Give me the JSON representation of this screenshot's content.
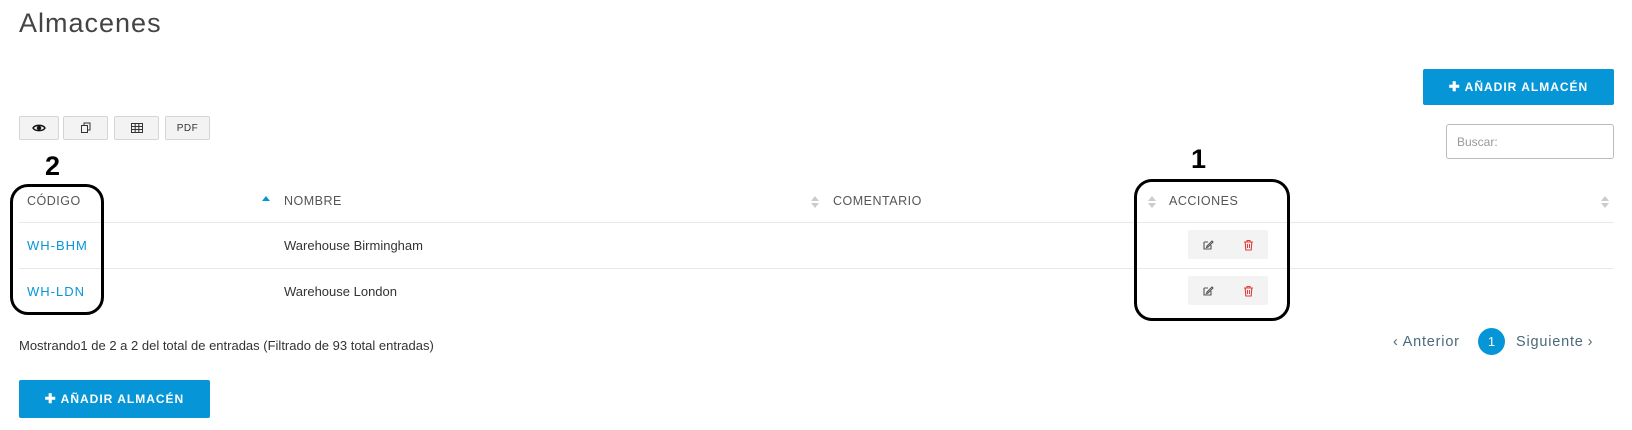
{
  "page": {
    "title": "Almacenes"
  },
  "actions": {
    "add_label": "AÑADIR ALMACÉN",
    "add_icon": "plus-icon"
  },
  "toolbar": {
    "view_icon": "eye-icon",
    "copy_icon": "copy-icon",
    "csv_icon": "table-icon",
    "pdf_label": "PDF"
  },
  "search": {
    "placeholder": "Buscar:",
    "value": ""
  },
  "table": {
    "columns": [
      "CÓDIGO",
      "NOMBRE",
      "COMENTARIO",
      "ACCIONES"
    ],
    "sorted_column": "NOMBRE",
    "sort_direction": "ascending",
    "rows": [
      {
        "codigo": "WH-BHM",
        "nombre": "Warehouse Birmingham",
        "comentario": ""
      },
      {
        "codigo": "WH-LDN",
        "nombre": "Warehouse London",
        "comentario": ""
      }
    ],
    "row_actions": [
      {
        "name": "edit-icon",
        "color": "#555555"
      },
      {
        "name": "trash-icon",
        "color": "#e03c3c"
      }
    ]
  },
  "annotations": {
    "label_1": "1",
    "label_2": "2"
  },
  "footer": {
    "info": "Mostrando1 de 2 a 2 del total de entradas (Filtrado de 93 total entradas)",
    "prev_label": "Anterior",
    "current_page": "1",
    "next_label": "Siguiente"
  },
  "colors": {
    "accent": "#0696d7",
    "danger": "#e03c3c",
    "annotation": "#000000"
  }
}
